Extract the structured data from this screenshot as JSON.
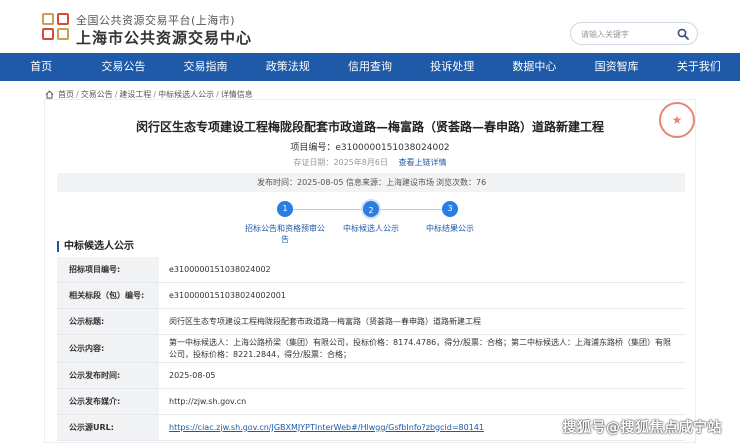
{
  "header": {
    "subtitle": "全国公共资源交易平台(上海市)",
    "title": "上海市公共资源交易中心",
    "search": {
      "placeholder": "请输入关键字"
    }
  },
  "nav": [
    "首页",
    "交易公告",
    "交易指南",
    "政策法规",
    "信用查询",
    "投诉处理",
    "数据中心",
    "国资智库",
    "关于我们"
  ],
  "breadcrumb": [
    "首页",
    "交易公告",
    "建设工程",
    "中标候选人公示",
    "详情信息"
  ],
  "detail": {
    "title": "闵行区生态专项建设工程梅陇段配套市政道路—梅富路（贤荟路—春申路）道路新建工程",
    "project_no": "项目编号：e3100000151038024002",
    "evidence_date": "存证日期：2025年8月6日",
    "evidence_link": "查看上链详情",
    "publish_time": "发布时间：2025-08-05",
    "source": "信息来源：上海建设市场",
    "views": "浏览次数：76"
  },
  "steps": [
    {
      "num": "1",
      "label_line1": "招标公告和资格预审公",
      "label_line2": "告"
    },
    {
      "num": "2",
      "label_line1": "中标候选人公示",
      "label_line2": ""
    },
    {
      "num": "3",
      "label_line1": "中标结果公示",
      "label_line2": ""
    }
  ],
  "section_title": "中标候选人公示",
  "table": [
    {
      "label": "招标项目编号:",
      "value": "e3100000151038024002"
    },
    {
      "label": "相关标段（包）编号:",
      "value": "e3100000151038024002001"
    },
    {
      "label": "公示标题:",
      "value": "闵行区生态专项建设工程梅陇段配套市政道路—梅富路（贤荟路—春申路）道路新建工程"
    },
    {
      "label": "公示内容:",
      "value": "第一中标候选人：上海公路桥梁（集团）有限公司，投标价格：8174.4786，得分/股票：合格；第二中标候选人：上海浦东路桥（集团）有限公司，投标价格：8221.2844，得分/股票：合格；"
    },
    {
      "label": "公示发布时间:",
      "value": "2025-08-05"
    },
    {
      "label": "公示发布媒介:",
      "value": "http://zjw.sh.gov.cn"
    },
    {
      "label": "公示源URL:",
      "value": "https://ciac.zjw.sh.gov.cn/JGBXMJYPTInterWeb#/Hlwgg/GsfbInfo?zbgcid=80141"
    }
  ],
  "watermark": "搜狐号@搜狐焦点咸宁站",
  "colors": {
    "nav_bg": "#1e5aa8",
    "accent": "#2a7de1",
    "stamp": "#e05a4a"
  }
}
